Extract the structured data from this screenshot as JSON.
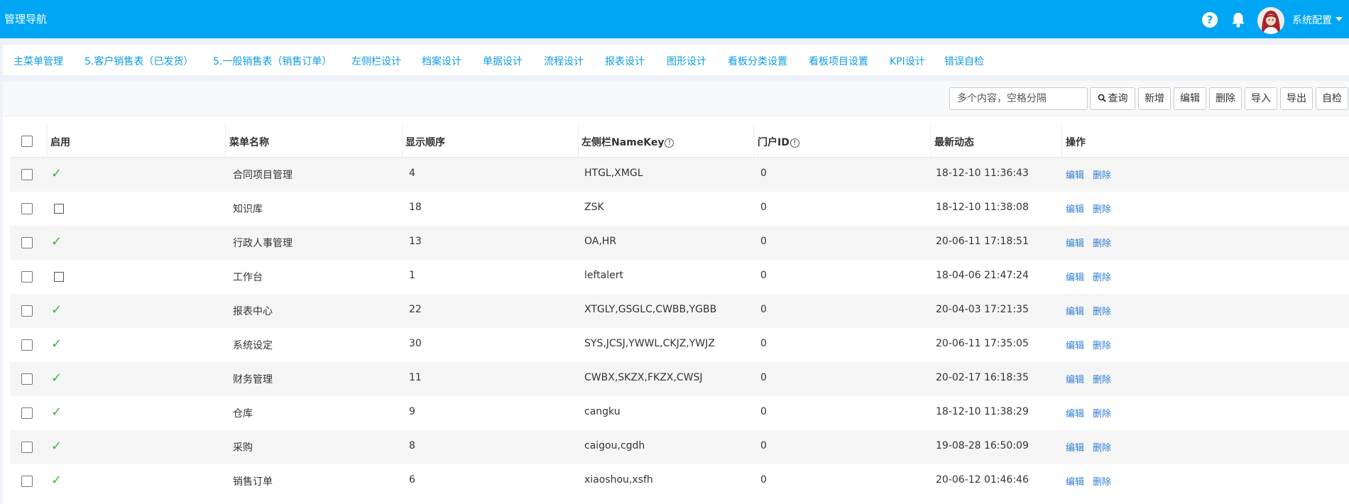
{
  "header": {
    "title": "管理导航",
    "help_glyph": "?",
    "user_name": "系统配置",
    "icons": [
      "help-icon",
      "bell-icon",
      "avatar",
      "chevron-down-icon"
    ]
  },
  "tabs": [
    "主菜单管理",
    "5.客户销售表（已发货）",
    "5.一般销售表（销售订单）",
    "左侧栏设计",
    "档案设计",
    "单据设计",
    "流程设计",
    "报表设计",
    "图形设计",
    "看板分类设置",
    "看板项目设置",
    "KPI设计",
    "错误自检"
  ],
  "toolbar": {
    "search_placeholder": "多个内容，空格分隔",
    "query": "查询",
    "add": "新增",
    "edit": "编辑",
    "delete": "删除",
    "import": "导入",
    "export": "导出",
    "selfcheck": "自检"
  },
  "table": {
    "columns": {
      "enabled": "启用",
      "menu_name": "菜单名称",
      "order": "显示顺序",
      "namekey": "左侧栏NameKey",
      "portal_id": "门户ID",
      "latest": "最新动态",
      "actions": "操作"
    },
    "info_glyph": "!",
    "row_actions": {
      "edit": "编辑",
      "delete": "删除"
    },
    "check_glyph": "✓",
    "rows": [
      {
        "enabled": true,
        "name": "合同项目管理",
        "order": "4",
        "namekey": "HTGL,XMGL",
        "portal": "0",
        "time": "18-12-10 11:36:43"
      },
      {
        "enabled": false,
        "name": "知识库",
        "order": "18",
        "namekey": "ZSK",
        "portal": "0",
        "time": "18-12-10 11:38:08"
      },
      {
        "enabled": true,
        "name": "行政人事管理",
        "order": "13",
        "namekey": "OA,HR",
        "portal": "0",
        "time": "20-06-11 17:18:51"
      },
      {
        "enabled": false,
        "name": "工作台",
        "order": "1",
        "namekey": "leftalert",
        "portal": "0",
        "time": "18-04-06 21:47:24"
      },
      {
        "enabled": true,
        "name": "报表中心",
        "order": "22",
        "namekey": "XTGLY,GSGLC,CWBB,YGBB",
        "portal": "0",
        "time": "20-04-03 17:21:35"
      },
      {
        "enabled": true,
        "name": "系统设定",
        "order": "30",
        "namekey": "SYS,JCSJ,YWWL,CKJZ,YWJZ",
        "portal": "0",
        "time": "20-06-11 17:35:05"
      },
      {
        "enabled": true,
        "name": "财务管理",
        "order": "11",
        "namekey": "CWBX,SKZX,FKZX,CWSJ",
        "portal": "0",
        "time": "20-02-17 16:18:35"
      },
      {
        "enabled": true,
        "name": "仓库",
        "order": "9",
        "namekey": "cangku",
        "portal": "0",
        "time": "18-12-10 11:38:29"
      },
      {
        "enabled": true,
        "name": "采购",
        "order": "8",
        "namekey": "caigou,cgdh",
        "portal": "0",
        "time": "19-08-28 16:50:09"
      },
      {
        "enabled": true,
        "name": "销售订单",
        "order": "6",
        "namekey": "xiaoshou,xsfh",
        "portal": "0",
        "time": "20-06-12 01:46:46"
      }
    ]
  }
}
